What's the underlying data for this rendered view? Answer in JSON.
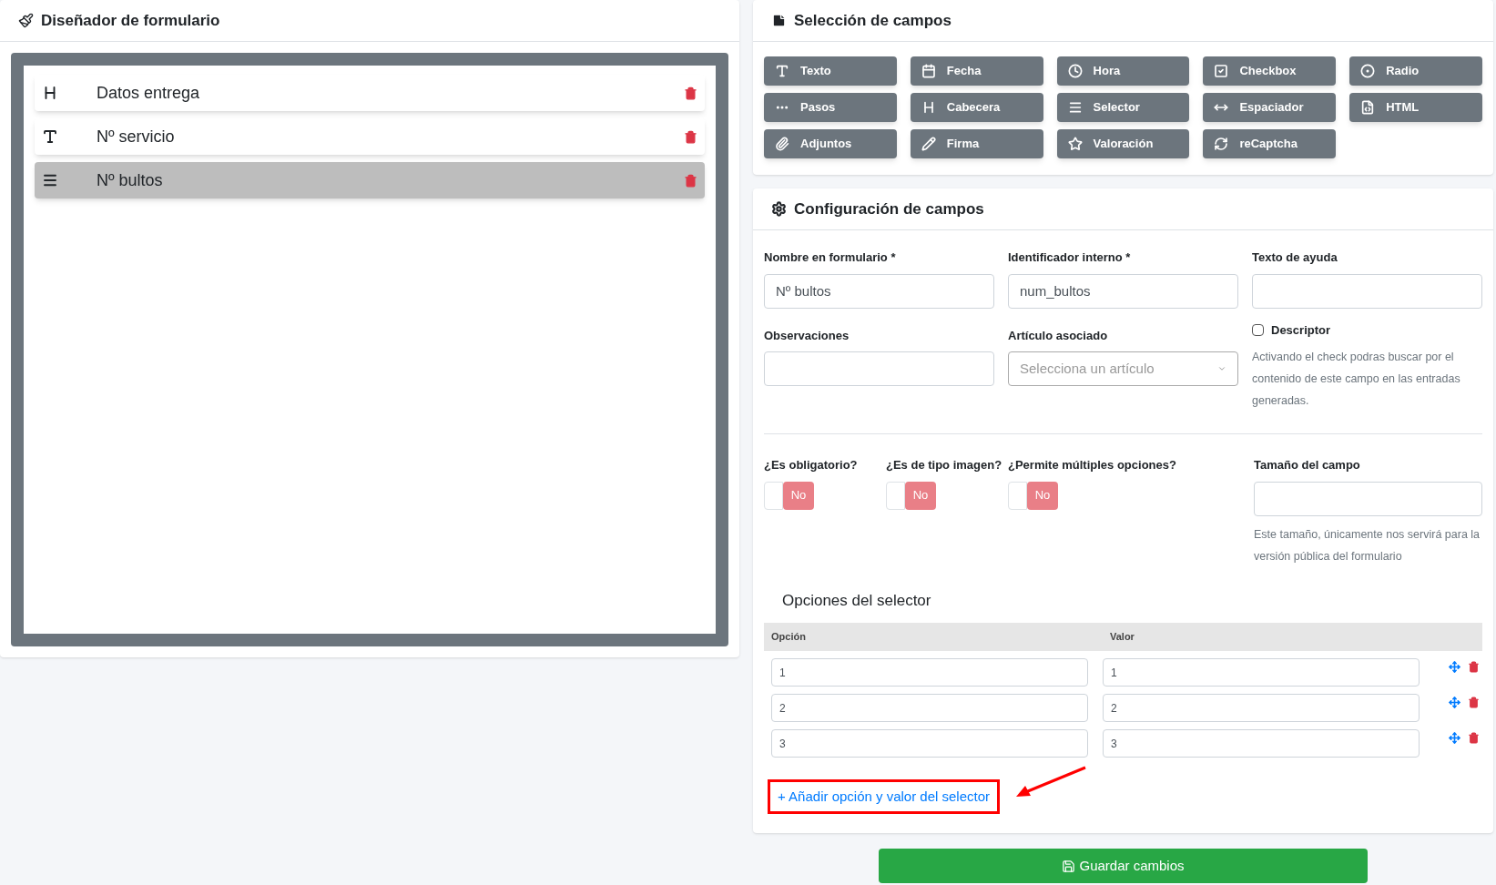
{
  "designer": {
    "title": "Diseñador de formulario",
    "items": [
      {
        "kind": "heading",
        "label": "Datos entrega",
        "selected": false
      },
      {
        "kind": "text",
        "label": "Nº servicio",
        "selected": false
      },
      {
        "kind": "list",
        "label": "Nº bultos",
        "selected": true
      }
    ]
  },
  "field_picker": {
    "title": "Selección de campos",
    "buttons": [
      {
        "kind": "text",
        "label": "Texto"
      },
      {
        "kind": "date",
        "label": "Fecha"
      },
      {
        "kind": "time",
        "label": "Hora"
      },
      {
        "kind": "checkbox",
        "label": "Checkbox"
      },
      {
        "kind": "radio",
        "label": "Radio"
      },
      {
        "kind": "steps",
        "label": "Pasos"
      },
      {
        "kind": "heading",
        "label": "Cabecera"
      },
      {
        "kind": "list",
        "label": "Selector"
      },
      {
        "kind": "spacer",
        "label": "Espaciador"
      },
      {
        "kind": "html",
        "label": "HTML"
      },
      {
        "kind": "attachment",
        "label": "Adjuntos"
      },
      {
        "kind": "signature",
        "label": "Firma"
      },
      {
        "kind": "rating",
        "label": "Valoración"
      },
      {
        "kind": "captcha",
        "label": "reCaptcha"
      }
    ]
  },
  "config": {
    "title": "Configuración de campos",
    "name_field": {
      "label": "Nombre en formulario *",
      "value": "Nº bultos"
    },
    "id_field": {
      "label": "Identificador interno *",
      "value": "num_bultos"
    },
    "help_field": {
      "label": "Texto de ayuda"
    },
    "notes_field": {
      "label": "Observaciones"
    },
    "article_field": {
      "label": "Artículo asociado",
      "placeholder": "Selecciona un artículo"
    },
    "descriptor": {
      "label": "Descriptor",
      "checked": false,
      "help": "Activando el check podras buscar por el contenido de este campo en las entradas generadas."
    },
    "toggles": [
      {
        "label": "¿Es obligatorio?",
        "on": false,
        "text": "No"
      },
      {
        "label": "¿Es de tipo imagen?",
        "on": false,
        "text": "No"
      },
      {
        "label": "¿Permite múltiples opciones?",
        "on": false,
        "text": "No"
      }
    ],
    "size_field": {
      "label": "Tamaño del campo",
      "help": "Este tamaño, únicamente nos servirá para la versión pública del formulario"
    },
    "options": {
      "title": "Opciones del selector",
      "columns": [
        "Opción",
        "Valor"
      ],
      "rows": [
        {
          "option": "1",
          "value": "1"
        },
        {
          "option": "2",
          "value": "2"
        },
        {
          "option": "3",
          "value": "3"
        }
      ],
      "add_link": "+ Añadir opción y valor del selector"
    }
  },
  "save_button": "Guardar cambios"
}
